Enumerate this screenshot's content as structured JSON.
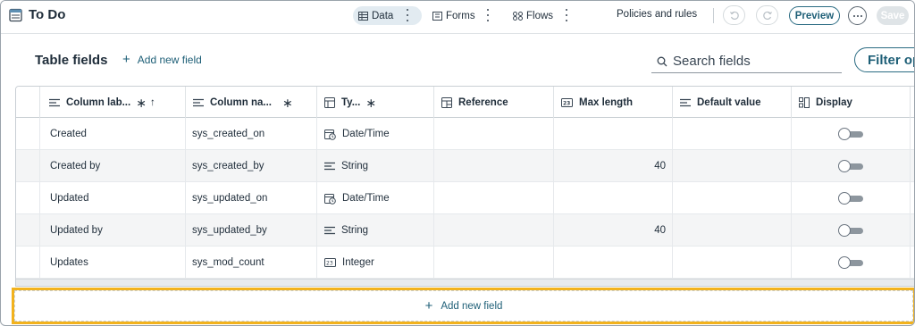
{
  "app": {
    "title": "To Do"
  },
  "tabs": [
    {
      "label": "Data",
      "active": true,
      "icon": "table-icon"
    },
    {
      "label": "Forms",
      "active": false,
      "icon": "form-icon"
    },
    {
      "label": "Flows",
      "active": false,
      "icon": "flow-icon"
    }
  ],
  "toolbar": {
    "policies_label": "Policies and rules",
    "preview_label": "Preview",
    "save_label": "Save",
    "undo_icon": "undo-icon",
    "redo_icon": "redo-icon",
    "more_icon": "more-icon"
  },
  "section": {
    "title": "Table fields",
    "add_field_label": "Add new field",
    "search_placeholder": "Search fields",
    "filter_label": "Filter op"
  },
  "table": {
    "columns": [
      {
        "label": "Column lab...",
        "required": true,
        "sortable": true,
        "icon": "text-lines-icon"
      },
      {
        "label": "Column na...",
        "required": true,
        "icon": "text-lines-icon"
      },
      {
        "label": "Ty...",
        "required": true,
        "icon": "type-icon"
      },
      {
        "label": "Reference",
        "icon": "reference-icon"
      },
      {
        "label": "Max length",
        "icon": "number-icon"
      },
      {
        "label": "Default value",
        "icon": "text-lines-icon"
      },
      {
        "label": "Display",
        "icon": "display-icon"
      }
    ],
    "required_marker": "∗",
    "sort_marker": "↑",
    "rows": [
      {
        "label": "Created",
        "name": "sys_created_on",
        "type": "Date/Time",
        "type_icon": "datetime-icon",
        "reference": "",
        "max_length": "",
        "default_value": "",
        "display": false
      },
      {
        "label": "Created by",
        "name": "sys_created_by",
        "type": "String",
        "type_icon": "string-icon",
        "reference": "",
        "max_length": "40",
        "default_value": "",
        "display": false
      },
      {
        "label": "Updated",
        "name": "sys_updated_on",
        "type": "Date/Time",
        "type_icon": "datetime-icon",
        "reference": "",
        "max_length": "",
        "default_value": "",
        "display": false
      },
      {
        "label": "Updated by",
        "name": "sys_updated_by",
        "type": "String",
        "type_icon": "string-icon",
        "reference": "",
        "max_length": "40",
        "default_value": "",
        "display": false
      },
      {
        "label": "Updates",
        "name": "sys_mod_count",
        "type": "Integer",
        "type_icon": "integer-icon",
        "reference": "",
        "max_length": "",
        "default_value": "",
        "display": false
      }
    ]
  },
  "footer": {
    "add_field_label": "Add new field"
  },
  "colors": {
    "accent": "#1e5f77",
    "highlight": "#f2b21d",
    "active_tab": "#e2ebf1"
  }
}
